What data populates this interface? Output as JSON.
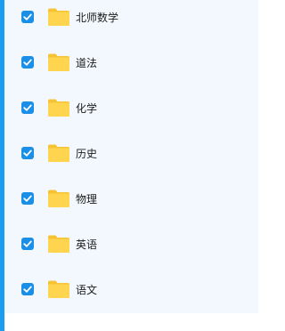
{
  "folders": [
    {
      "name": "北师数学",
      "checked": true,
      "icon": "folder-icon",
      "checkbox_icon": "check-icon"
    },
    {
      "name": "道法",
      "checked": true,
      "icon": "folder-icon",
      "checkbox_icon": "check-icon"
    },
    {
      "name": "化学",
      "checked": true,
      "icon": "folder-icon",
      "checkbox_icon": "check-icon"
    },
    {
      "name": "历史",
      "checked": true,
      "icon": "folder-icon",
      "checkbox_icon": "check-icon"
    },
    {
      "name": "物理",
      "checked": true,
      "icon": "folder-icon",
      "checkbox_icon": "check-icon"
    },
    {
      "name": "英语",
      "checked": true,
      "icon": "folder-icon",
      "checkbox_icon": "check-icon"
    },
    {
      "name": "语文",
      "checked": true,
      "icon": "folder-icon",
      "checkbox_icon": "check-icon"
    }
  ],
  "colors": {
    "accent": "#1a9cf0",
    "checkbox": "#1a8fe8",
    "panel_background": "#f2f8fd",
    "folder_body": "#ffd54f",
    "folder_back": "#f6c334"
  }
}
